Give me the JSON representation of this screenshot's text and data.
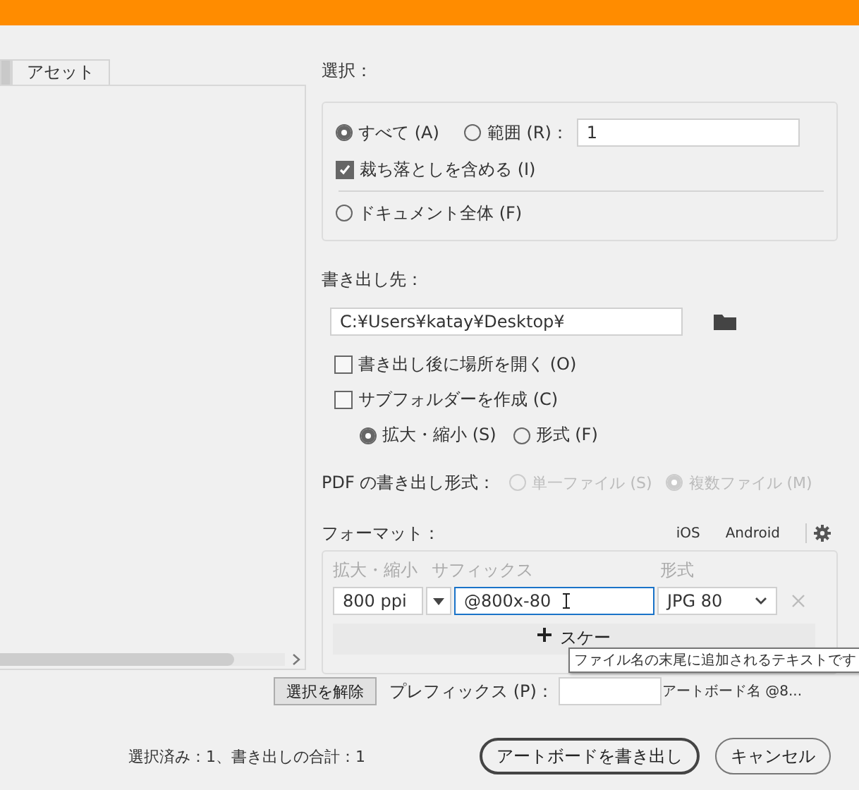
{
  "tabs": [
    {
      "selected": true
    },
    {
      "label": "アセット",
      "selected": false
    }
  ],
  "selection": {
    "title": "選択：",
    "all": {
      "label": "すべて (A)",
      "selected": true
    },
    "range": {
      "label": "範囲 (R)：",
      "selected": false,
      "value": "1"
    },
    "bleed": {
      "label": "裁ち落としを含める (I)",
      "checked": true
    },
    "document": {
      "label": "ドキュメント全体 (F)",
      "selected": false
    }
  },
  "destination": {
    "title": "書き出し先：",
    "path": "C:¥Users¥katay¥Desktop¥",
    "open_after": {
      "label": "書き出し後に場所を開く (O)",
      "checked": false
    },
    "subfolder": {
      "label": "サブフォルダーを作成 (C)",
      "checked": false
    },
    "subfolder_by": [
      {
        "label": "拡大・縮小 (S)",
        "selected": true
      },
      {
        "label": "形式 (F)",
        "selected": false
      }
    ]
  },
  "pdf": {
    "title": "PDF の書き出し形式：",
    "options": [
      {
        "label": "単一ファイル (S)",
        "selected": false,
        "disabled": true
      },
      {
        "label": "複数ファイル (M)",
        "selected": true,
        "disabled": true
      }
    ]
  },
  "format": {
    "title": "フォーマット：",
    "presets": [
      "iOS",
      "Android"
    ],
    "columns": [
      "拡大・縮小",
      "サフィックス",
      "形式"
    ],
    "rows": [
      {
        "scale": "800 ppi",
        "suffix": "@800x-80",
        "format": "JPG 80"
      }
    ],
    "add_scale": "スケー",
    "tooltip": "ファイル名の末尾に追加されるテキストです"
  },
  "deselect": "選択を解除",
  "prefix": {
    "label": "プレフィックス (P)：",
    "hint": "アートボード名 @8..."
  },
  "status": "選択済み：1、書き出しの合計：1",
  "buttons": [
    {
      "label": "アートボードを書き出し",
      "default": true
    },
    {
      "label": "キャンセル",
      "default": false
    }
  ]
}
